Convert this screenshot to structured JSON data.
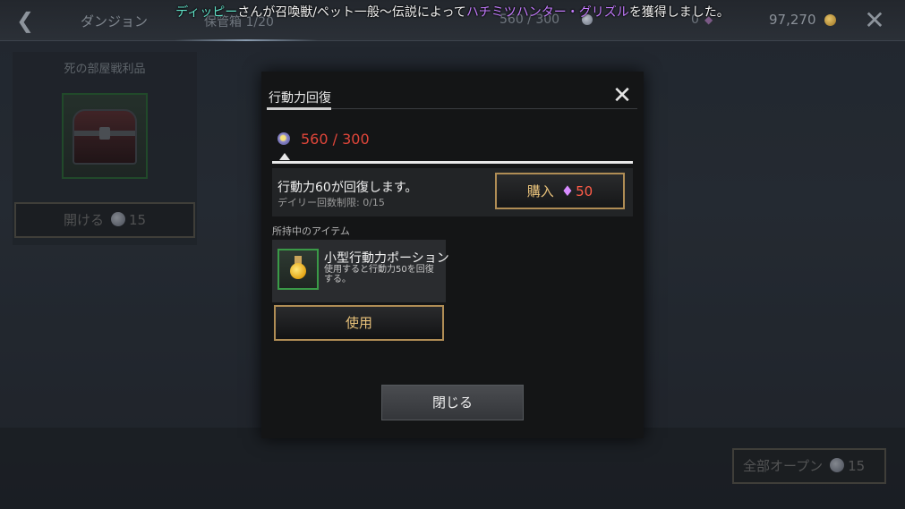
{
  "topbar": {
    "title": "ダンジョン",
    "storage": "保管箱 1/20",
    "stamina": "560 / 300",
    "gems": "0",
    "gold": "97,270"
  },
  "broadcast": {
    "player": "ディッピー",
    "text1": "さんが召喚獣/ペット一般～伝説によって",
    "item": "ハチミツハンター・グリズル",
    "text2": "を獲得しました。"
  },
  "loot": {
    "title": "死の部屋戦利品",
    "open_label": "開ける",
    "open_cost": "15"
  },
  "open_all": {
    "label": "全部オープン",
    "cost": "15"
  },
  "modal": {
    "title": "行動力回復",
    "stamina_current": "560",
    "stamina_separator": "/",
    "stamina_max": "300",
    "recover_text": "行動力60が回復します。",
    "daily_limit": "デイリー回数制限: 0/15",
    "buy_label": "購入",
    "buy_price": "50",
    "owned_label": "所持中のアイテム",
    "item_name": "小型行動力ポーション",
    "item_desc": "使用すると行動力50を回復する。",
    "use_label": "使用",
    "close_label": "閉じる"
  },
  "colors": {
    "stamina_red": "#e0463a",
    "gold_button_border": "#b08d55",
    "player_name": "#61e3c9",
    "item_name": "#c57cff"
  }
}
